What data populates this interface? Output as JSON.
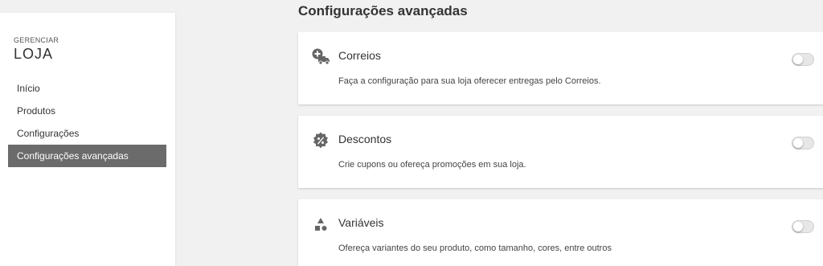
{
  "sidebar": {
    "subtitle": "GERENCIAR",
    "title": "LOJA",
    "items": [
      {
        "label": "Início",
        "active": false
      },
      {
        "label": "Produtos",
        "active": false
      },
      {
        "label": "Configurações",
        "active": false
      },
      {
        "label": "Configurações avançadas",
        "active": true
      }
    ]
  },
  "main": {
    "title": "Configurações avançadas",
    "cards": [
      {
        "icon": "truck-plus-icon",
        "title": "Correios",
        "description": "Faça a configuração para sua loja oferecer entregas pelo Correios.",
        "enabled": false
      },
      {
        "icon": "discount-badge-icon",
        "title": "Descontos",
        "description": "Crie cupons ou ofereça promoções em sua loja.",
        "enabled": false
      },
      {
        "icon": "shapes-icon",
        "title": "Variáveis",
        "description": "Ofereça variantes do seu produto, como tamanho, cores, entre outros",
        "enabled": false
      }
    ]
  },
  "colors": {
    "background": "#f1f1f1",
    "active_nav": "#6b6b6b",
    "icon": "#666666"
  }
}
